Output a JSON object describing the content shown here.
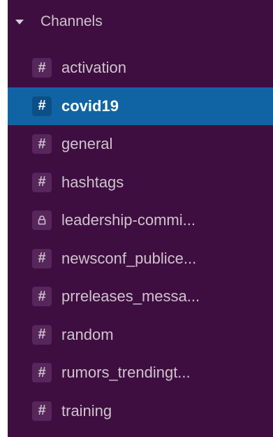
{
  "section": {
    "title": "Channels",
    "toggle_icon": "caret-down-icon"
  },
  "colors": {
    "sidebar_bg": "#3f0e40",
    "active_bg": "#1164a3",
    "text": "#cfc3cf",
    "icon_bg": "#57265a"
  },
  "channels": [
    {
      "name": "activation",
      "icon": "hash-icon",
      "active": false
    },
    {
      "name": "covid19",
      "icon": "hash-icon",
      "active": true
    },
    {
      "name": "general",
      "icon": "hash-icon",
      "active": false
    },
    {
      "name": "hashtags",
      "icon": "hash-icon",
      "active": false
    },
    {
      "name": "leadership-commi...",
      "icon": "lock-icon",
      "active": false
    },
    {
      "name": "newsconf_publice...",
      "icon": "hash-icon",
      "active": false
    },
    {
      "name": "prreleases_messa...",
      "icon": "hash-icon",
      "active": false
    },
    {
      "name": "random",
      "icon": "hash-icon",
      "active": false
    },
    {
      "name": "rumors_trendingt...",
      "icon": "hash-icon",
      "active": false
    },
    {
      "name": "training",
      "icon": "hash-icon",
      "active": false
    }
  ]
}
